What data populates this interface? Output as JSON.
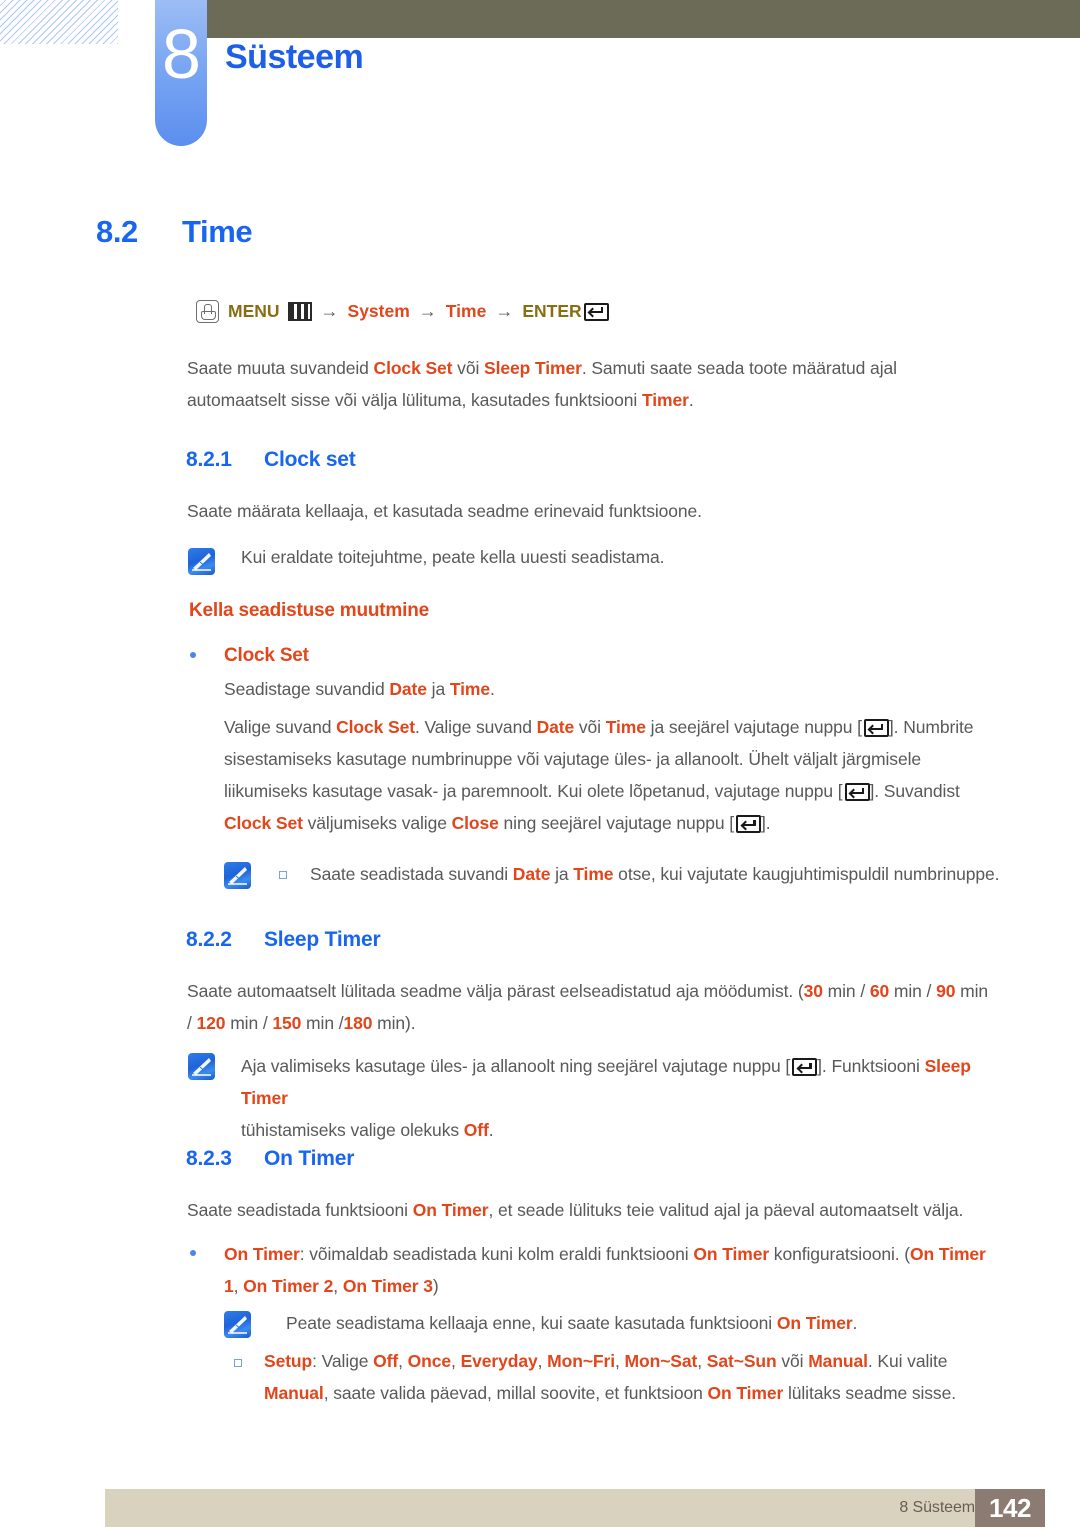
{
  "header": {
    "chapter_number": "8",
    "chapter_title": "Süsteem"
  },
  "section": {
    "number": "8.2",
    "title": "Time"
  },
  "menu_path": {
    "hand_icon": "hand-press-icon",
    "menu_label": "MENU",
    "grid_icon": "menu-grid-icon",
    "arrow": "→",
    "item1": "System",
    "item2": "Time",
    "enter_label": "ENTER",
    "enter_icon": "enter-key-icon"
  },
  "intro": {
    "line1_a": "Saate muuta suvandeid ",
    "line1_b": "Clock Set",
    "line1_c": " või ",
    "line1_d": "Sleep Timer",
    "line1_e": ". Samuti saate seada toote määratud ajal",
    "line2_a": "automaatselt sisse või välja lülituma, kasutades funktsiooni ",
    "line2_b": "Timer",
    "line2_c": "."
  },
  "clock_set": {
    "number": "8.2.1",
    "title": "Clock set",
    "desc": "Saate määrata kellaaja, et kasutada seadme erinevaid funktsioone.",
    "note": "Kui eraldate toitejuhtme, peate kella uuesti seadistama.",
    "subhead": "Kella seadistuse muutmine",
    "bullet_label": "Clock Set",
    "bullet_line_a": "Seadistage suvandid ",
    "bullet_line_b": "Date",
    "bullet_line_c": " ja ",
    "bullet_line_d": "Time",
    "bullet_line_e": ".",
    "p1_a": "Valige suvand ",
    "p1_b": "Clock Set",
    "p1_c": ". Valige suvand ",
    "p1_d": "Date",
    "p1_e": " või ",
    "p1_f": "Time",
    "p1_g": " ja seejärel vajutage nuppu [",
    "p1_h": "]. Numbrite",
    "p2": "sisestamiseks kasutage numbrinuppe või vajutage üles- ja allanoolt. Ühelt väljalt järgmisele",
    "p3_a": "liikumiseks kasutage vasak- ja paremnoolt. Kui olete lõpetanud, vajutage nuppu [",
    "p3_b": "]. Suvandist",
    "p4_a": "Clock Set",
    "p4_b": " väljumiseks valige ",
    "p4_c": "Close",
    "p4_d": " ning seejärel vajutage nuppu [",
    "p4_e": "].",
    "subnote_a": "Saate seadistada suvandi ",
    "subnote_b": "Date",
    "subnote_c": " ja ",
    "subnote_d": "Time",
    "subnote_e": " otse, kui vajutate kaugjuhtimispuldil numbrinuppe."
  },
  "sleep_timer": {
    "number": "8.2.2",
    "title": "Sleep Timer",
    "p1_a": "Saate automaatselt lülitada seadme välja pärast eelseadistatud aja möödumist. (",
    "p1_v1": "30",
    "p1_b": " min / ",
    "p1_v2": "60",
    "p1_c": " min / ",
    "p1_v3": "90",
    "p1_d": " min",
    "p2_a": "/ ",
    "p2_v4": "120",
    "p2_b": " min / ",
    "p2_v5": "150",
    "p2_c": " min /",
    "p2_v6": "180",
    "p2_d": " min).",
    "note1_a": "Aja valimiseks kasutage üles- ja allanoolt ning seejärel vajutage nuppu [",
    "note1_b": "]. Funktsiooni ",
    "note1_c": "Sleep Timer",
    "note2_a": "tühistamiseks valige olekuks ",
    "note2_b": "Off",
    "note2_c": "."
  },
  "on_timer": {
    "number": "8.2.3",
    "title": "On Timer",
    "p1_a": "Saate seadistada funktsiooni ",
    "p1_b": "On Timer",
    "p1_c": ", et seade lülituks teie valitud ajal ja päeval automaatselt välja.",
    "b1_a": "On Timer",
    "b1_b": ": võimaldab seadistada kuni kolm eraldi funktsiooni ",
    "b1_c": "On Timer",
    "b1_d": " konfiguratsiooni. (",
    "b1_e": "On Timer",
    "b2_a": "1",
    "b2_b": ", ",
    "b2_c": "On Timer 2",
    "b2_d": ", ",
    "b2_e": "On Timer 3",
    "b2_f": ")",
    "note_a": "Peate seadistama kellaaja enne, kui saate kasutada funktsiooni ",
    "note_b": "On Timer",
    "note_c": ".",
    "setup_label": "Setup",
    "setup_a": ": Valige ",
    "opt1": "Off",
    "opt2": "Once",
    "opt3": "Everyday",
    "opt4": "Mon~Fri",
    "opt5": "Mon~Sat",
    "opt6": "Sat~Sun",
    "setup_b": " või ",
    "opt7": "Manual",
    "setup_c": ". Kui valite",
    "setup2_a": "Manual",
    "setup2_b": ", saate valida päevad, millal soovite, et funktsioon ",
    "setup2_c": "On Timer",
    "setup2_d": " lülitaks seadme sisse."
  },
  "footer": {
    "chapter_ref": "8 Süsteem",
    "page_number": "142"
  },
  "colors": {
    "heading_blue": "#1866f0",
    "accent_orange": "#e2461a",
    "olive": "#6c6b58",
    "menu_olive_text": "#8a6d10",
    "body_gray": "#58595b",
    "footer_beige": "#d8d2bf",
    "footer_brown": "#8c7b73"
  }
}
